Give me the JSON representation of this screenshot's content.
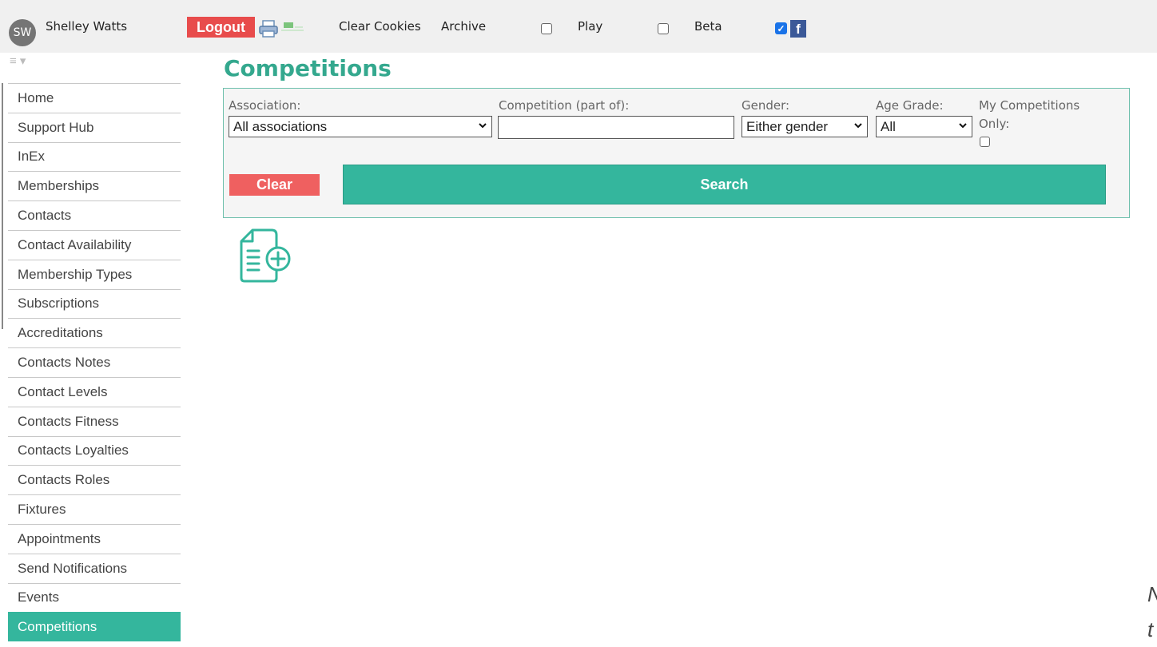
{
  "user": {
    "initials": "SW",
    "name": "Shelley Watts"
  },
  "topbar": {
    "logout_label": "Logout",
    "clear_cookies_label": "Clear Cookies",
    "archive_label": "Archive",
    "play_label": "Play",
    "play_checked": false,
    "beta_label": "Beta",
    "beta_checked": false,
    "facebook_checked": true,
    "facebook_glyph": "f"
  },
  "sidebar": {
    "items": [
      {
        "label": "Home"
      },
      {
        "label": "Support Hub"
      },
      {
        "label": "InEx"
      },
      {
        "label": "Memberships"
      },
      {
        "label": "Contacts"
      },
      {
        "label": "Contact Availability"
      },
      {
        "label": "Membership Types"
      },
      {
        "label": "Subscriptions"
      },
      {
        "label": "Accreditations"
      },
      {
        "label": "Contacts Notes"
      },
      {
        "label": "Contact Levels"
      },
      {
        "label": "Contacts Fitness"
      },
      {
        "label": "Contacts Loyalties"
      },
      {
        "label": "Contacts Roles"
      },
      {
        "label": "Fixtures"
      },
      {
        "label": "Appointments"
      },
      {
        "label": "Send Notifications"
      },
      {
        "label": "Events"
      },
      {
        "label": "Competitions",
        "active": true
      }
    ]
  },
  "page": {
    "title": "Competitions"
  },
  "filters": {
    "association_label": "Association:",
    "association_value": "All associations",
    "competition_label": "Competition (part of):",
    "competition_value": "",
    "gender_label": "Gender:",
    "gender_value": "Either gender",
    "age_grade_label": "Age Grade:",
    "age_grade_value": "All",
    "my_competitions_label_1": "My Competitions",
    "my_competitions_label_2": "Only:",
    "my_competitions_checked": false,
    "clear_label": "Clear",
    "search_label": "Search"
  },
  "edge_text": {
    "line1": "N",
    "line2": "t"
  },
  "colors": {
    "accent": "#34b69d",
    "danger": "#e84c4c",
    "title": "#34a88e"
  }
}
